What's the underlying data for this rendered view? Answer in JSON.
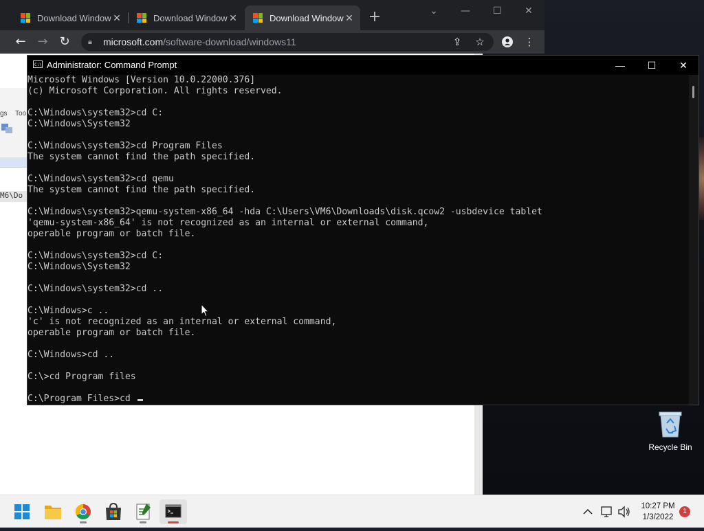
{
  "browser": {
    "tabs": [
      {
        "title": "Download Window",
        "active": false
      },
      {
        "title": "Download Window",
        "active": false
      },
      {
        "title": "Download Window",
        "active": true
      }
    ],
    "url_host": "microsoft.com",
    "url_path": "/software-download/windows11"
  },
  "background_app": {
    "snippet_1": "gs",
    "snippet_2": "Too",
    "path_fragment": "M6\\Do"
  },
  "cmd": {
    "title": "Administrator: Command Prompt",
    "lines": [
      "Microsoft Windows [Version 10.0.22000.376]",
      "(c) Microsoft Corporation. All rights reserved.",
      "",
      "C:\\Windows\\system32>cd C:",
      "C:\\Windows\\System32",
      "",
      "C:\\Windows\\system32>cd Program Files",
      "The system cannot find the path specified.",
      "",
      "C:\\Windows\\system32>cd qemu",
      "The system cannot find the path specified.",
      "",
      "C:\\Windows\\system32>qemu-system-x86_64 -hda C:\\Users\\VM6\\Downloads\\disk.qcow2 -usbdevice tablet",
      "'qemu-system-x86_64' is not recognized as an internal or external command,",
      "operable program or batch file.",
      "",
      "C:\\Windows\\system32>cd C:",
      "C:\\Windows\\System32",
      "",
      "C:\\Windows\\system32>cd ..",
      "",
      "C:\\Windows>c ..",
      "'c' is not recognized as an internal or external command,",
      "operable program or batch file.",
      "",
      "C:\\Windows>cd ..",
      "",
      "C:\\>cd Program files",
      "",
      "C:\\Program Files>cd "
    ]
  },
  "desktop": {
    "recycle_bin_label": "Recycle Bin"
  },
  "taskbar": {
    "apps": [
      "start-icon",
      "file-explorer-icon",
      "chrome-icon",
      "microsoft-store-icon",
      "notepad-icon",
      "command-prompt-icon"
    ],
    "time": "10:27 PM",
    "date": "1/3/2022",
    "notification_count": "1"
  },
  "colors": {
    "console_bg": "#0c0c0c",
    "console_text": "#cccccc",
    "chrome_dark": "#202124",
    "taskbar_bg": "#f2f2f2"
  }
}
